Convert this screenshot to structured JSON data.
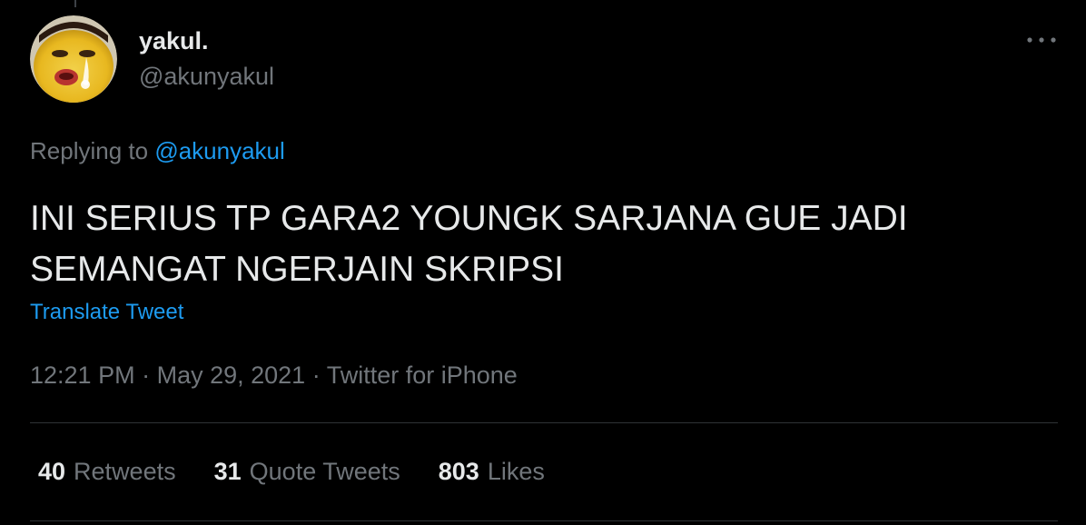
{
  "tweet": {
    "author": {
      "display_name": "yakul.",
      "handle": "@akunyakul",
      "avatar_icon": "crying-face-avatar"
    },
    "more_icon": "more-dots-icon",
    "replying": {
      "prefix": "Replying to",
      "mention": "@akunyakul"
    },
    "text_lines": [
      "INI SERIUS TP GARA2 YOUNGK SARJANA GUE JADI",
      "SEMANGAT NGERJAIN SKRIPSI"
    ],
    "translate_label": "Translate Tweet",
    "meta": {
      "time": "12:21 PM",
      "separator": " · ",
      "date": "May 29, 2021",
      "source": "Twitter for iPhone"
    },
    "stats": [
      {
        "count": "40",
        "label": "Retweets"
      },
      {
        "count": "31",
        "label": "Quote Tweets"
      },
      {
        "count": "803",
        "label": "Likes"
      }
    ]
  },
  "colors": {
    "background": "#000000",
    "primary_text": "#e7e9ea",
    "secondary_text": "#71767b",
    "link": "#1d9bf0",
    "divider": "#2f3336"
  }
}
